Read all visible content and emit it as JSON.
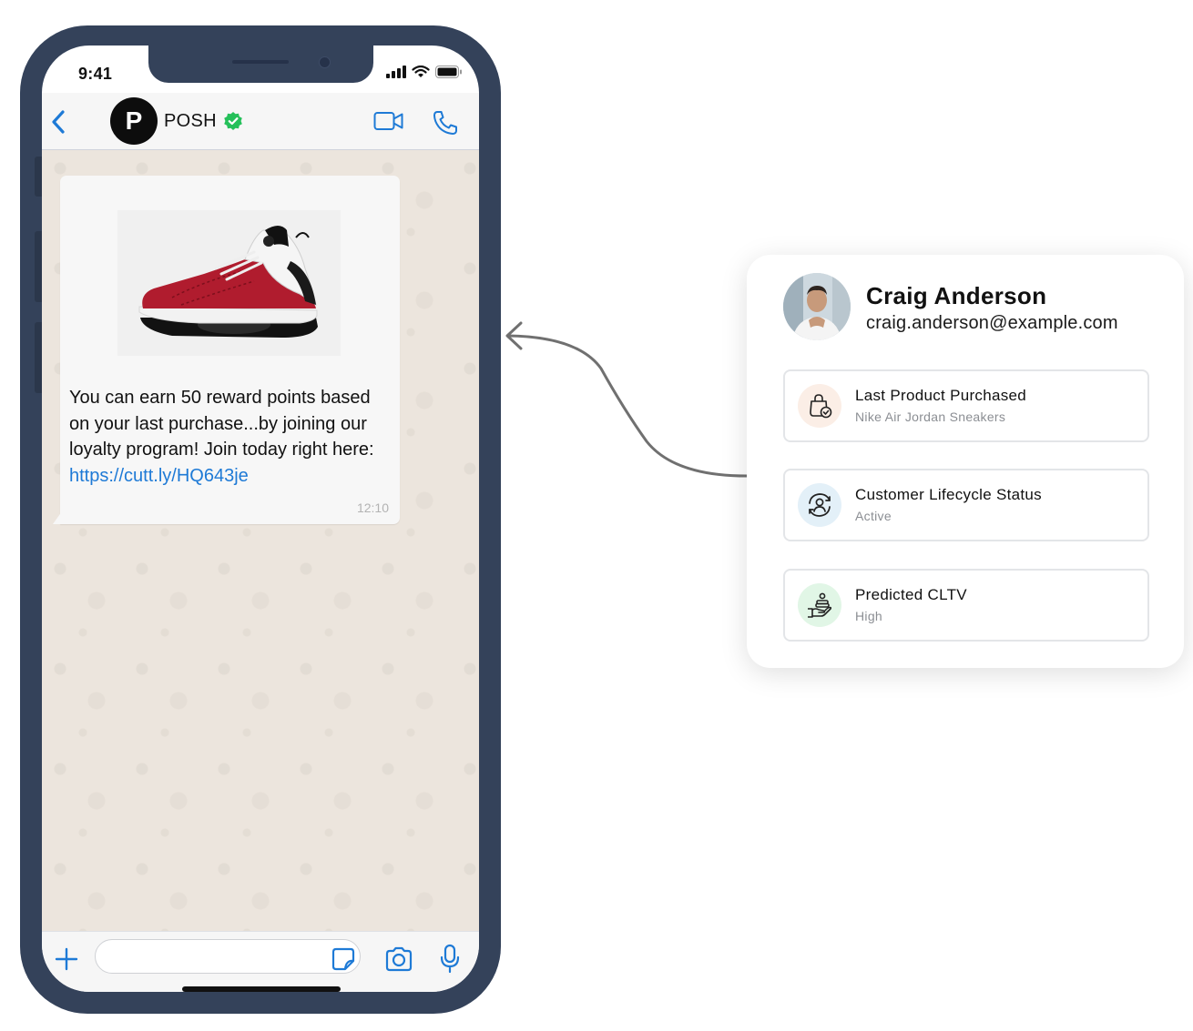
{
  "status_bar": {
    "time": "9:41"
  },
  "chat_header": {
    "avatar_letter": "P",
    "brand_name": "POSH"
  },
  "message": {
    "text": "You can earn 50 reward points based on your last purchase...by joining our loyalty program! Join today right here:",
    "link": "https://cutt.ly/HQ643je",
    "time": "12:10"
  },
  "input_bar": {
    "value": ""
  },
  "customer": {
    "name": "Craig Anderson",
    "email": "craig.anderson@example.com",
    "attributes": [
      {
        "title": "Last Product Purchased",
        "value": "Nike Air Jordan Sneakers",
        "icon": "shopping-bag-check-icon",
        "icon_bg": "#fbeee6"
      },
      {
        "title": "Customer Lifecycle Status",
        "value": "Active",
        "icon": "user-cycle-icon",
        "icon_bg": "#e3f0f8"
      },
      {
        "title": "Predicted CLTV",
        "value": "High",
        "icon": "hand-coins-icon",
        "icon_bg": "#e1f6e6"
      }
    ]
  },
  "colors": {
    "phone_frame": "#34425a",
    "ios_blue": "#1e7ad6",
    "verified_green": "#25c05a",
    "chat_bg": "#ece5dd"
  }
}
